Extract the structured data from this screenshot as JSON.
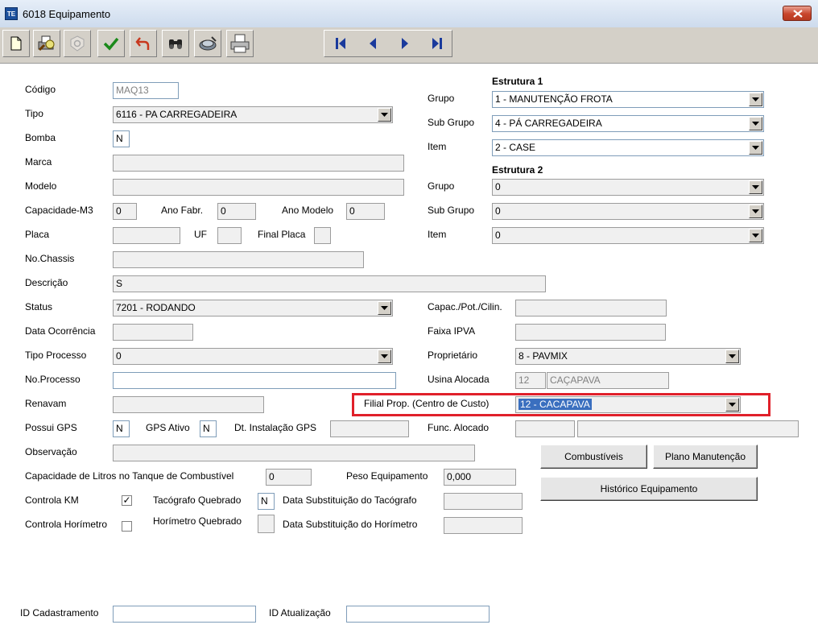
{
  "window": {
    "title": "6018 Equipamento",
    "app_icon_text": "TE"
  },
  "toolbar": {
    "buttons": [
      "new-document-icon",
      "print-preview-icon",
      "disabled-settings-icon",
      "confirm-check-icon",
      "undo-arrow-icon",
      "search-binoculars-icon",
      "database-icon",
      "printer-icon"
    ],
    "nav": [
      "first-record-icon",
      "previous-record-icon",
      "next-record-icon",
      "last-record-icon"
    ]
  },
  "form": {
    "codigo": {
      "label": "Código",
      "value": "MAQ13"
    },
    "tipo": {
      "label": "Tipo",
      "value": "6116 - PA CARREGADEIRA"
    },
    "bomba": {
      "label": "Bomba",
      "value": "N"
    },
    "marca": {
      "label": "Marca",
      "value": ""
    },
    "modelo": {
      "label": "Modelo",
      "value": ""
    },
    "capacidade": {
      "label": "Capacidade-M3",
      "value": "0"
    },
    "ano_fabr": {
      "label": "Ano Fabr.",
      "value": "0"
    },
    "ano_modelo": {
      "label": "Ano Modelo",
      "value": "0"
    },
    "placa": {
      "label": "Placa",
      "value": ""
    },
    "uf": {
      "label": "UF",
      "value": ""
    },
    "final_placa": {
      "label": "Final Placa",
      "value": ""
    },
    "chassis": {
      "label": "No.Chassis",
      "value": ""
    },
    "descricao": {
      "label": "Descrição",
      "value": "S"
    },
    "status": {
      "label": "Status",
      "value": "7201 - RODANDO"
    },
    "data_ocorrencia": {
      "label": "Data Ocorrência",
      "value": ""
    },
    "tipo_processo": {
      "label": "Tipo Processo",
      "value": "0"
    },
    "no_processo": {
      "label": "No.Processo",
      "value": ""
    },
    "renavam": {
      "label": "Renavam",
      "value": ""
    },
    "possui_gps": {
      "label": "Possui GPS",
      "value": "N"
    },
    "gps_ativo": {
      "label": "GPS Ativo",
      "value": "N"
    },
    "dt_instalacao_gps": {
      "label": "Dt. Instalação GPS",
      "value": ""
    },
    "observacao": {
      "label": "Observação",
      "value": ""
    },
    "capacidade_litros": {
      "label": "Capacidade de Litros no Tanque de Combustível",
      "value": "0"
    },
    "peso": {
      "label": "Peso Equipamento",
      "value": "0,000"
    },
    "controla_km": {
      "label": "Controla KM",
      "checked": "✓"
    },
    "tacografo_quebrado": {
      "label": "Tacógrafo Quebrado",
      "value": "N"
    },
    "data_subst_tacografo": {
      "label": "Data Substituição do Tacógrafo",
      "value": ""
    },
    "controla_horimetro": {
      "label": "Controla Horímetro",
      "checked": ""
    },
    "horimetro_quebrado": {
      "label": "Horímetro Quebrado",
      "value": ""
    },
    "data_subst_horimetro": {
      "label": "Data Substituição do Horímetro",
      "value": ""
    },
    "id_cadastramento": {
      "label": "ID Cadastramento",
      "value": ""
    },
    "id_atualizacao": {
      "label": "ID Atualização",
      "value": ""
    }
  },
  "estrutura1": {
    "heading": "Estrutura 1",
    "grupo": {
      "label": "Grupo",
      "value": "1 - MANUTENÇÃO FROTA"
    },
    "sub_grupo": {
      "label": "Sub Grupo",
      "value": "4 - PÁ CARREGADEIRA"
    },
    "item": {
      "label": "Item",
      "value": "2 - CASE"
    }
  },
  "estrutura2": {
    "heading": "Estrutura 2",
    "grupo": {
      "label": "Grupo",
      "value": "0"
    },
    "sub_grupo": {
      "label": "Sub Grupo",
      "value": "0"
    },
    "item": {
      "label": "Item",
      "value": "0"
    }
  },
  "right": {
    "capac_pot": {
      "label": "Capac./Pot./Cilin.",
      "value": ""
    },
    "faixa_ipva": {
      "label": "Faixa IPVA",
      "value": ""
    },
    "proprietario": {
      "label": "Proprietário",
      "value": "8 - PAVMIX"
    },
    "usina_alocada": {
      "label": "Usina Alocada",
      "code": "12",
      "name": "CAÇAPAVA"
    },
    "filial_prop": {
      "label": "Filial Prop. (Centro de Custo)",
      "value": "12 - CACAPAVA"
    },
    "func_alocado": {
      "label": "Func. Alocado",
      "code": "",
      "name": ""
    }
  },
  "buttons": {
    "combustiveis": "Combustíveis",
    "plano_manutencao": "Plano Manutenção",
    "historico": "Histórico Equipamento"
  },
  "colors": {
    "highlight": "#e0202a",
    "selection": "#3a6fbf"
  }
}
